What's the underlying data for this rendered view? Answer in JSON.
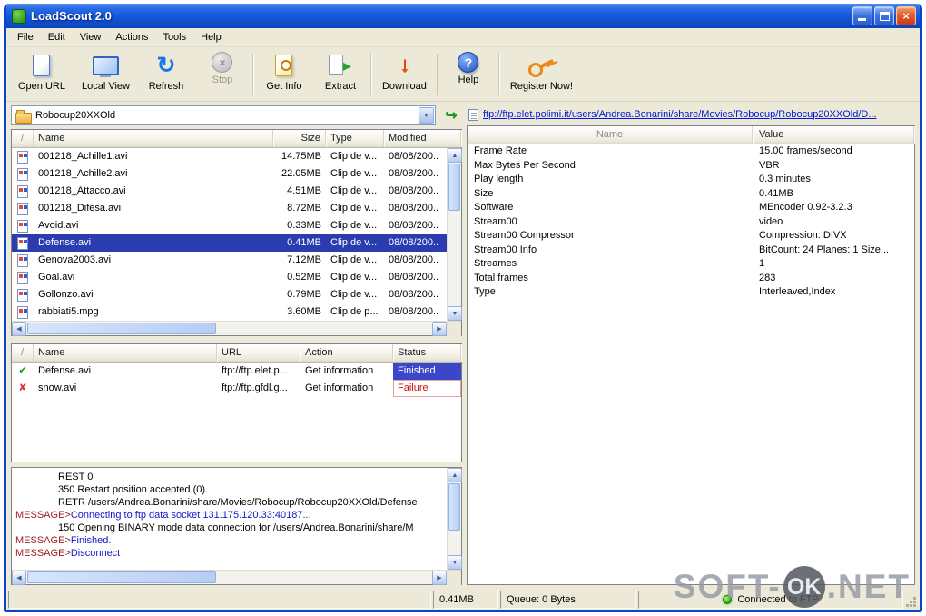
{
  "window": {
    "title": "LoadScout 2.0"
  },
  "menu": {
    "items": [
      "File",
      "Edit",
      "View",
      "Actions",
      "Tools",
      "Help"
    ]
  },
  "toolbar": {
    "items": [
      {
        "label": "Open URL",
        "icon": "open-url-icon"
      },
      {
        "label": "Local View",
        "icon": "local-view-icon"
      },
      {
        "label": "Refresh",
        "icon": "refresh-icon"
      },
      {
        "label": "Stop",
        "icon": "stop-icon",
        "disabled": true
      },
      {
        "type": "separator"
      },
      {
        "label": "Get Info",
        "icon": "get-info-icon"
      },
      {
        "label": "Extract",
        "icon": "extract-icon"
      },
      {
        "type": "separator"
      },
      {
        "label": "Download",
        "icon": "download-icon"
      },
      {
        "type": "separator"
      },
      {
        "label": "Help",
        "icon": "help-icon"
      },
      {
        "type": "separator"
      },
      {
        "label": "Register Now!",
        "icon": "register-icon"
      }
    ]
  },
  "file_browser": {
    "address": "Robocup20XXOld",
    "columns": [
      "Name",
      "Size",
      "Type",
      "Modified"
    ],
    "selected": "Defense.avi",
    "rows": [
      [
        "001218_Achille1.avi",
        "14.75MB",
        "Clip de v...",
        "08/08/200.."
      ],
      [
        "001218_Achille2.avi",
        "22.05MB",
        "Clip de v...",
        "08/08/200.."
      ],
      [
        "001218_Attacco.avi",
        "4.51MB",
        "Clip de v...",
        "08/08/200.."
      ],
      [
        "001218_Difesa.avi",
        "8.72MB",
        "Clip de v...",
        "08/08/200.."
      ],
      [
        "Avoid.avi",
        "0.33MB",
        "Clip de v...",
        "08/08/200.."
      ],
      [
        "Defense.avi",
        "0.41MB",
        "Clip de v...",
        "08/08/200.."
      ],
      [
        "Genova2003.avi",
        "7.12MB",
        "Clip de v...",
        "08/08/200.."
      ],
      [
        "Goal.avi",
        "0.52MB",
        "Clip de v...",
        "08/08/200.."
      ],
      [
        "Gollonzo.avi",
        "0.79MB",
        "Clip de v...",
        "08/08/200.."
      ],
      [
        "rabbiati5.mpg",
        "3.60MB",
        "Clip de p...",
        "08/08/200.."
      ]
    ]
  },
  "properties": {
    "url": "ftp://ftp.elet.polimi.it/users/Andrea.Bonarini/share/Movies/Robocup/Robocup20XXOld/D...",
    "columns": [
      "Name",
      "Value"
    ],
    "rows": [
      [
        "Frame Rate",
        "15.00 frames/second"
      ],
      [
        "Max Bytes Per Second",
        "VBR"
      ],
      [
        "Play length",
        "0.3 minutes"
      ],
      [
        "Size",
        "0.41MB"
      ],
      [
        "Software",
        "MEncoder 0.92-3.2.3"
      ],
      [
        "Stream00",
        "video"
      ],
      [
        "Stream00 Compressor",
        "Compression: DIVX"
      ],
      [
        "Stream00 Info",
        "BitCount: 24 Planes: 1 Size..."
      ],
      [
        "Streames",
        "1"
      ],
      [
        "Total frames",
        "283"
      ],
      [
        "Type",
        "Interleaved,Index"
      ]
    ]
  },
  "queue": {
    "columns": [
      "Name",
      "URL",
      "Action",
      "Status"
    ],
    "rows": [
      {
        "icon": "check",
        "name": "Defense.avi",
        "url": "ftp://ftp.elet.p...",
        "action": "Get information",
        "status": "Finished",
        "state": "finished"
      },
      {
        "icon": "error",
        "name": "snow.avi",
        "url": "ftp://ftp.gfdl.g...",
        "action": "Get information",
        "status": "Failure",
        "state": "failure"
      }
    ]
  },
  "log": {
    "lines": [
      {
        "text": "REST 0"
      },
      {
        "text": "350 Restart position accepted (0)."
      },
      {
        "text": "RETR /users/Andrea.Bonarini/share/Movies/Robocup/Robocup20XXOld/Defense"
      },
      {
        "prefix": "MESSAGE>",
        "text": "Connecting to ftp data socket 131.175.120.33:40187..."
      },
      {
        "text": "150 Opening BINARY mode data connection for /users/Andrea.Bonarini/share/M"
      },
      {
        "prefix": "MESSAGE>",
        "text": "Finished."
      },
      {
        "prefix": "MESSAGE>",
        "text": "Disconnect"
      }
    ]
  },
  "status_bar": {
    "size": "0.41MB",
    "queue": "Queue: 0 Bytes",
    "connection": "Connected to FTP"
  },
  "watermark": {
    "left": "SOFT-",
    "badge": "OK",
    "right": ".NET"
  },
  "icons": {
    "sort-icon": "/",
    "dropdown-icon": "▼",
    "refresh-icon": "↻",
    "stop-icon": "×",
    "extract-icon": "▶",
    "download-icon": "↓",
    "help-icon": "?",
    "go-icon": "↪",
    "check-icon": "✔",
    "error-icon": "✘",
    "scroll-up-icon": "▲",
    "scroll-down-icon": "▼",
    "scroll-left-icon": "◀",
    "scroll-right-icon": "▶",
    "close-icon": "×",
    "open-url-icon": "",
    "local-view-icon": "",
    "get-info-icon": "",
    "register-icon": "",
    "folder-icon": "",
    "link-icon": "",
    "connected-icon": "",
    "video-file-icon": ""
  },
  "colors": {
    "titlebar": "#1658da",
    "selection": "#2a3cb0",
    "finished_bg": "#3c46c8",
    "failure_text": "#cc1010",
    "link": "#0018d8",
    "message_prefix": "#9b1c1c",
    "message_text": "#1515cc",
    "chrome": "#ece9d8"
  }
}
